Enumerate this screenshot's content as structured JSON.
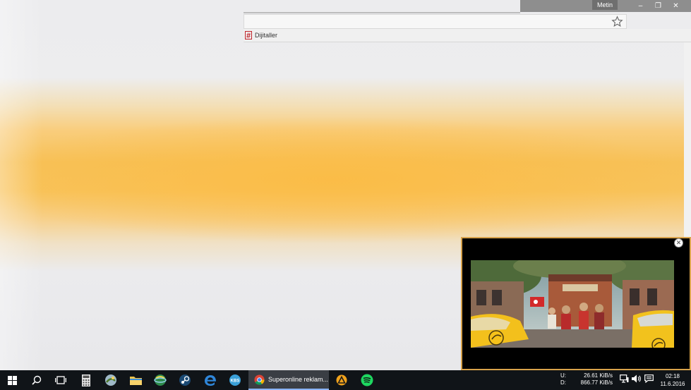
{
  "window": {
    "profile_name": "Metin",
    "minimize_glyph": "–",
    "restore_glyph": "❐",
    "close_glyph": "✕"
  },
  "bookmarks_bar": {
    "items": [
      {
        "label": "Dijitaller",
        "icon": "hash-favicon"
      }
    ]
  },
  "popup": {
    "close_glyph": "✕",
    "video_icon": "turkcell-logo-icon"
  },
  "taskbar": {
    "start_icon": "windows-start-icon",
    "pinned": [
      "search-icon",
      "task-view-icon",
      "calculator-icon",
      "photo-viewer-icon",
      "file-explorer-icon",
      "network-globe-icon",
      "steam-icon",
      "edge-icon",
      "kbs-app-icon",
      "chrome-icon",
      "aimp-icon",
      "spotify-icon"
    ],
    "active_task": {
      "label": "Superonline reklam...",
      "icon": "chrome-icon"
    },
    "network": {
      "up_label": "U:",
      "up_value": "26.61 KiB/s",
      "down_label": "D:",
      "down_value": "866.77 KiB/s"
    },
    "tray": [
      "network-icon",
      "volume-icon",
      "action-center-icon"
    ],
    "clock": {
      "time": "02:18",
      "date": "11.6.2016"
    }
  },
  "colors": {
    "taskbar_bg": "#101418",
    "popup_border": "#d8a24a",
    "title_strip": "#8e8e8e",
    "backdrop_accent": "#f7c158"
  }
}
